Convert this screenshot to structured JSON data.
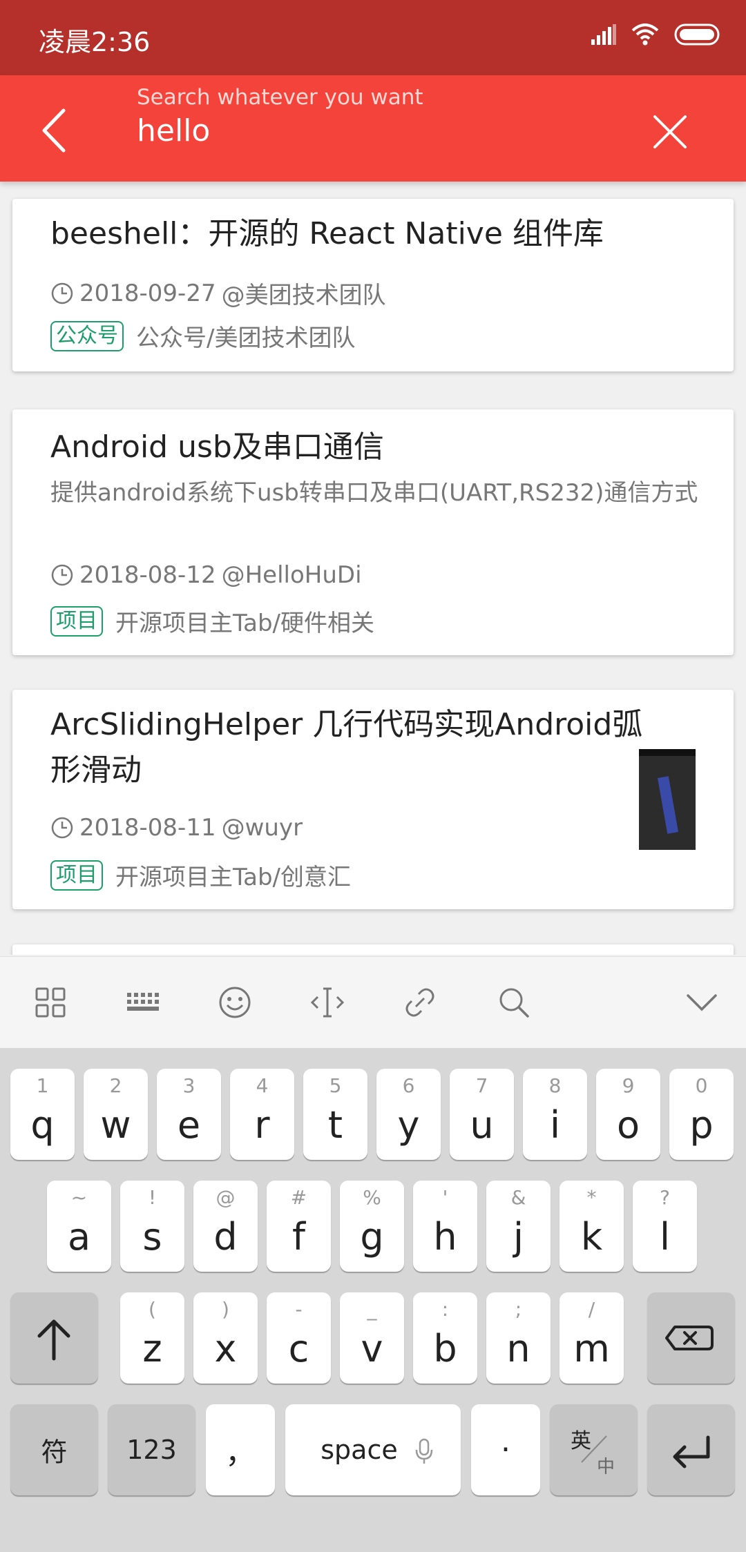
{
  "status": {
    "time": "凌晨2:36"
  },
  "search": {
    "hint": "Search whatever you want",
    "value": "hello"
  },
  "articles": [
    {
      "title": "beeshell：开源的 React Native 组件库",
      "date": "2018-09-27",
      "author": "@美团技术团队",
      "tag": "公众号",
      "category": "公众号/美团技术团队"
    },
    {
      "title": "Android usb及串口通信",
      "desc": "提供android系统下usb转串口及串口(UART,RS232)通信方式",
      "date": "2018-08-12",
      "author": "@HelloHuDi",
      "tag": "项目",
      "category": "开源项目主Tab/硬件相关"
    },
    {
      "title_line1": "ArcSlidingHelper 几行代码实现Android弧",
      "title_line2": "形滑动",
      "date": "2018-08-11",
      "author": "@wuyr",
      "tag": "项目",
      "category": "开源项目主Tab/创意汇"
    }
  ],
  "keyboard": {
    "row1": [
      {
        "sub": "1",
        "main": "q"
      },
      {
        "sub": "2",
        "main": "w"
      },
      {
        "sub": "3",
        "main": "e"
      },
      {
        "sub": "4",
        "main": "r"
      },
      {
        "sub": "5",
        "main": "t"
      },
      {
        "sub": "6",
        "main": "y"
      },
      {
        "sub": "7",
        "main": "u"
      },
      {
        "sub": "8",
        "main": "i"
      },
      {
        "sub": "9",
        "main": "o"
      },
      {
        "sub": "0",
        "main": "p"
      }
    ],
    "row2": [
      {
        "sub": "~",
        "main": "a"
      },
      {
        "sub": "!",
        "main": "s"
      },
      {
        "sub": "@",
        "main": "d"
      },
      {
        "sub": "#",
        "main": "f"
      },
      {
        "sub": "%",
        "main": "g"
      },
      {
        "sub": "'",
        "main": "h"
      },
      {
        "sub": "&",
        "main": "j"
      },
      {
        "sub": "*",
        "main": "k"
      },
      {
        "sub": "?",
        "main": "l"
      }
    ],
    "row3": [
      {
        "sub": "(",
        "main": "z"
      },
      {
        "sub": ")",
        "main": "x"
      },
      {
        "sub": "-",
        "main": "c"
      },
      {
        "sub": "_",
        "main": "v"
      },
      {
        "sub": ":",
        "main": "b"
      },
      {
        "sub": ";",
        "main": "n"
      },
      {
        "sub": "/",
        "main": "m"
      }
    ],
    "symbol_key": "符",
    "num_key": "123",
    "comma_key": "，",
    "space_key": "space",
    "period_key": "·",
    "lang_top": "英",
    "lang_bottom": "中"
  }
}
